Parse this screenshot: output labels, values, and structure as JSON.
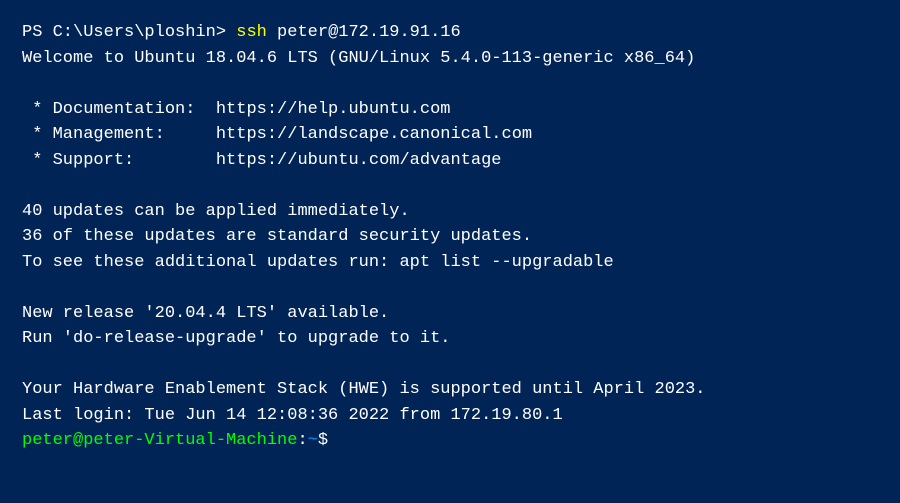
{
  "prompt1": {
    "prefix": "PS C:\\Users\\ploshin> ",
    "cmd_exe": "ssh",
    "cmd_args": " peter@172.19.91.16"
  },
  "welcome": "Welcome to Ubuntu 18.04.6 LTS (GNU/Linux 5.4.0-113-generic x86_64)",
  "links": {
    "doc_label": " * Documentation:  ",
    "doc_url": "https://help.ubuntu.com",
    "mgmt_label": " * Management:     ",
    "mgmt_url": "https://landscape.canonical.com",
    "support_label": " * Support:        ",
    "support_url": "https://ubuntu.com/advantage"
  },
  "updates": {
    "line1": "40 updates can be applied immediately.",
    "line2": "36 of these updates are standard security updates.",
    "line3": "To see these additional updates run: apt list --upgradable"
  },
  "release": {
    "line1": "New release '20.04.4 LTS' available.",
    "line2": "Run 'do-release-upgrade' to upgrade to it."
  },
  "hwe": "Your Hardware Enablement Stack (HWE) is supported until April 2023.",
  "last_login": "Last login: Tue Jun 14 12:08:36 2022 from 172.19.80.1",
  "prompt2": {
    "userhost": "peter@peter-Virtual-Machine",
    "sep": ":",
    "path": "~",
    "sym": "$"
  }
}
